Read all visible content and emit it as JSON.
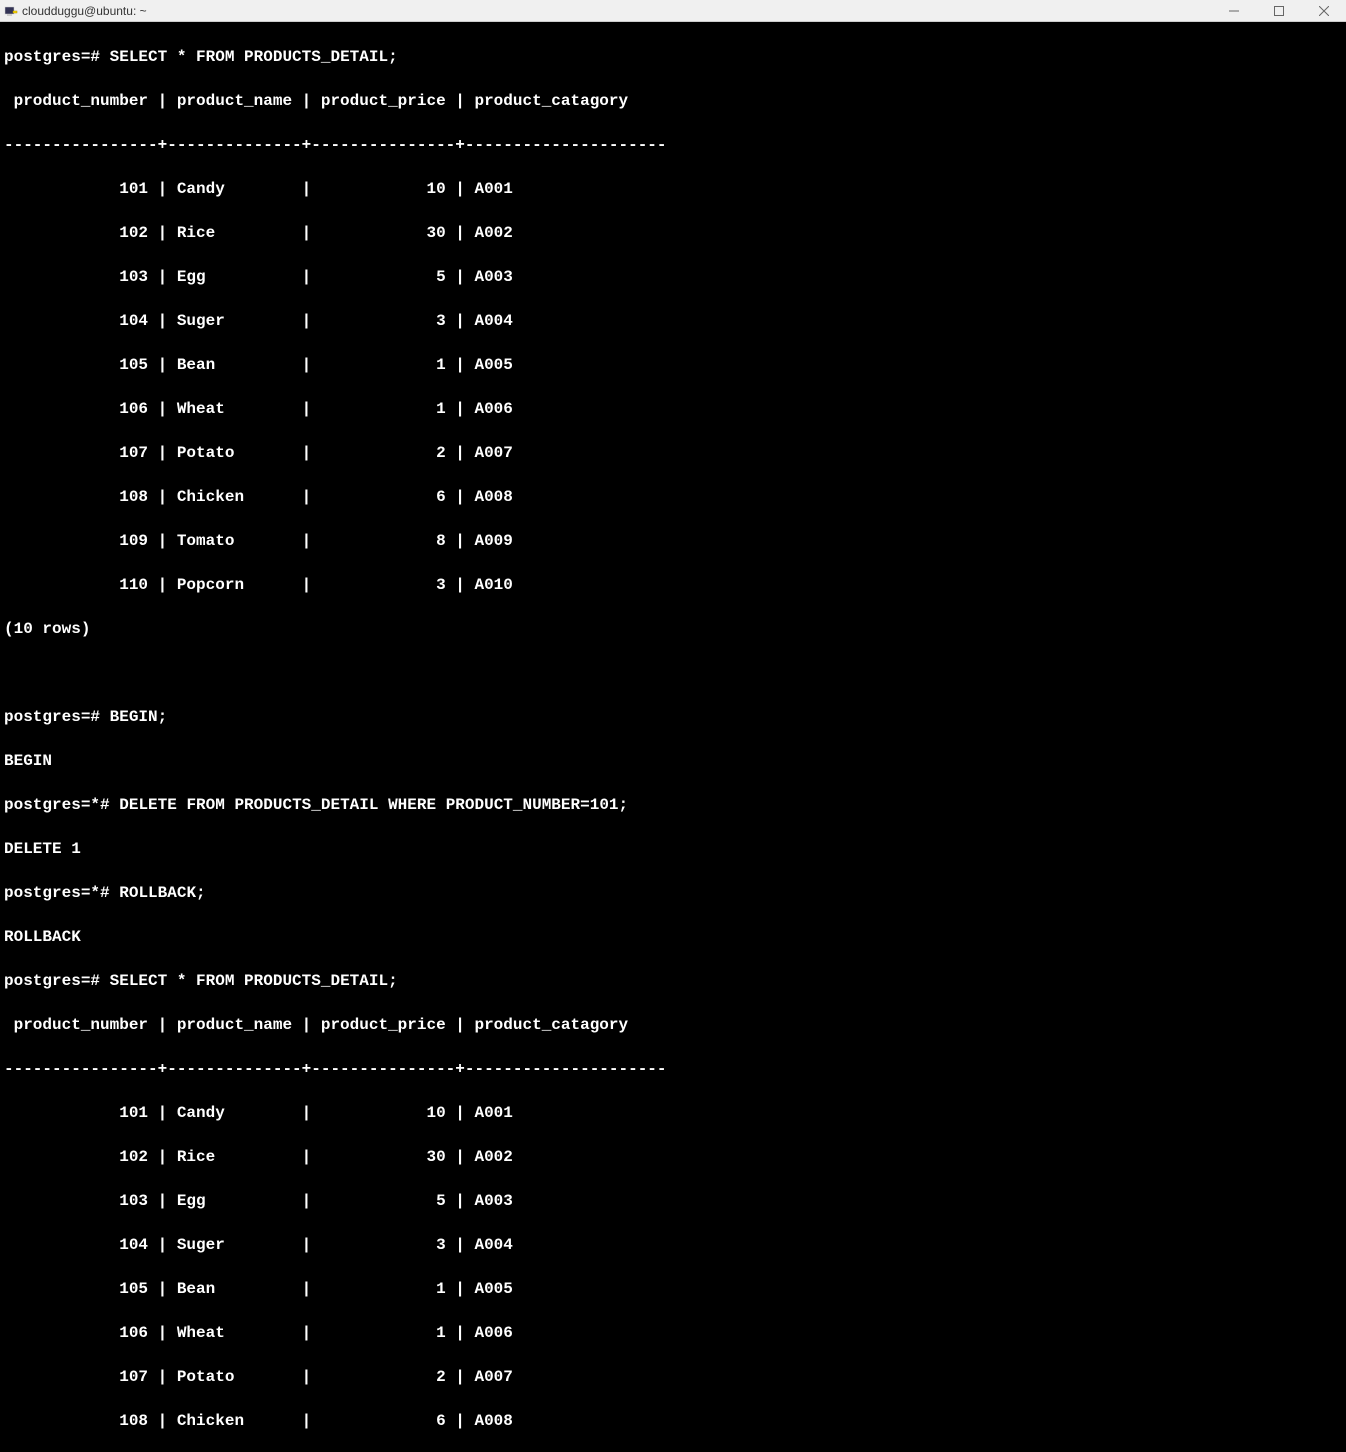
{
  "window": {
    "title": "cloudduggu@ubuntu: ~",
    "icon_name": "putty-icon"
  },
  "prompts": {
    "normal": "postgres=#",
    "transaction": "postgres=*#"
  },
  "sql": {
    "select": "SELECT * FROM PRODUCTS_DETAIL;",
    "begin": "BEGIN;",
    "delete": "DELETE FROM PRODUCTS_DETAIL WHERE PRODUCT_NUMBER=101;",
    "rollback": "ROLLBACK;"
  },
  "responses": {
    "begin": "BEGIN",
    "delete": "DELETE 1",
    "rollback": "ROLLBACK",
    "rowcount": "(10 rows)"
  },
  "table": {
    "header": " product_number | product_name | product_price | product_catagory",
    "separator": "----------------+--------------+---------------+---------------------",
    "columns": [
      "product_number",
      "product_name",
      "product_price",
      "product_catagory"
    ],
    "rows_formatted": [
      "            101 | Candy        |            10 | A001",
      "            102 | Rice         |            30 | A002",
      "            103 | Egg          |             5 | A003",
      "            104 | Suger        |             3 | A004",
      "            105 | Bean         |             1 | A005",
      "            106 | Wheat        |             1 | A006",
      "            107 | Potato       |             2 | A007",
      "            108 | Chicken      |             6 | A008",
      "            109 | Tomato       |             8 | A009",
      "            110 | Popcorn      |             3 | A010"
    ],
    "rows": [
      {
        "product_number": 101,
        "product_name": "Candy",
        "product_price": 10,
        "product_catagory": "A001"
      },
      {
        "product_number": 102,
        "product_name": "Rice",
        "product_price": 30,
        "product_catagory": "A002"
      },
      {
        "product_number": 103,
        "product_name": "Egg",
        "product_price": 5,
        "product_catagory": "A003"
      },
      {
        "product_number": 104,
        "product_name": "Suger",
        "product_price": 3,
        "product_catagory": "A004"
      },
      {
        "product_number": 105,
        "product_name": "Bean",
        "product_price": 1,
        "product_catagory": "A005"
      },
      {
        "product_number": 106,
        "product_name": "Wheat",
        "product_price": 1,
        "product_catagory": "A006"
      },
      {
        "product_number": 107,
        "product_name": "Potato",
        "product_price": 2,
        "product_catagory": "A007"
      },
      {
        "product_number": 108,
        "product_name": "Chicken",
        "product_price": 6,
        "product_catagory": "A008"
      },
      {
        "product_number": 109,
        "product_name": "Tomato",
        "product_price": 8,
        "product_catagory": "A009"
      },
      {
        "product_number": 110,
        "product_name": "Popcorn",
        "product_price": 3,
        "product_catagory": "A010"
      }
    ]
  },
  "second_table_visible_row_count": 8
}
